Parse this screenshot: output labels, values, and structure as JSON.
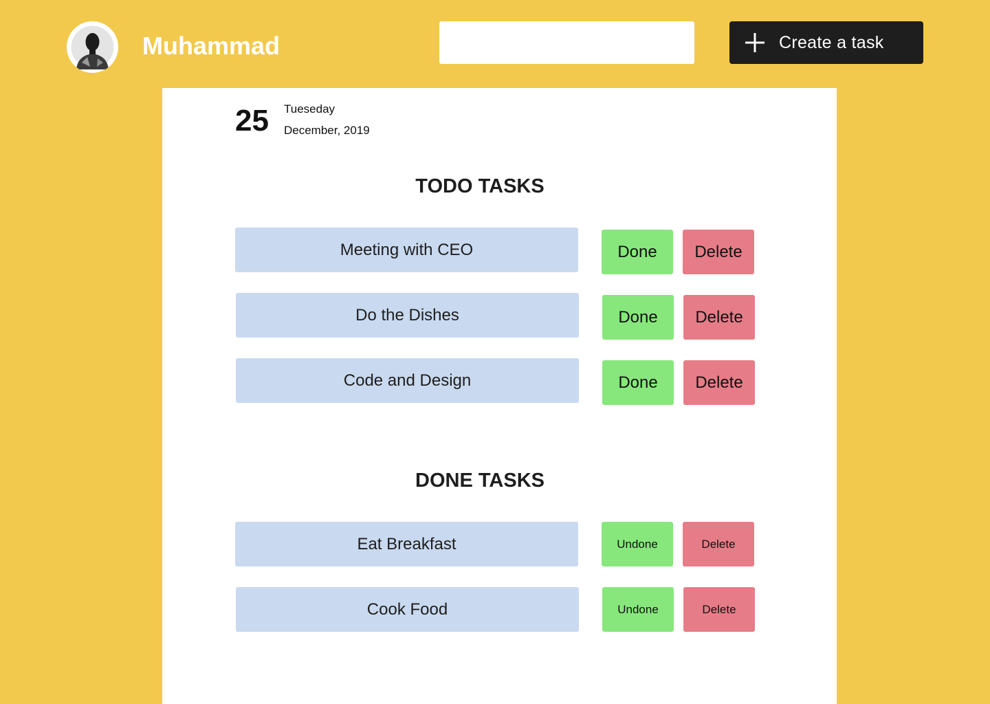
{
  "header": {
    "username": "Muhammad",
    "search": {
      "value": "",
      "placeholder": ""
    },
    "create_button_label": "Create a task",
    "avatar_icon": "user-avatar"
  },
  "date": {
    "day": "25",
    "weekday": "Tueseday",
    "month_year": "December, 2019"
  },
  "todo": {
    "heading": "TODO TASKS",
    "tasks": [
      {
        "title": "Meeting with CEO",
        "done_label": "Done",
        "delete_label": "Delete"
      },
      {
        "title": "Do the Dishes",
        "done_label": "Done",
        "delete_label": "Delete"
      },
      {
        "title": "Code and Design",
        "done_label": "Done",
        "delete_label": "Delete"
      }
    ]
  },
  "done": {
    "heading": "DONE TASKS",
    "tasks": [
      {
        "title": "Eat Breakfast",
        "undone_label": "Undone",
        "delete_label": "Delete"
      },
      {
        "title": "Cook Food",
        "undone_label": "Undone",
        "delete_label": "Delete"
      }
    ]
  },
  "colors": {
    "background": "#F2C94C",
    "panel": "#FFFFFF",
    "task_box": "#C9D9EF",
    "done_button": "#87E77C",
    "delete_button": "#E67C87",
    "create_button": "#1E1E1E"
  }
}
